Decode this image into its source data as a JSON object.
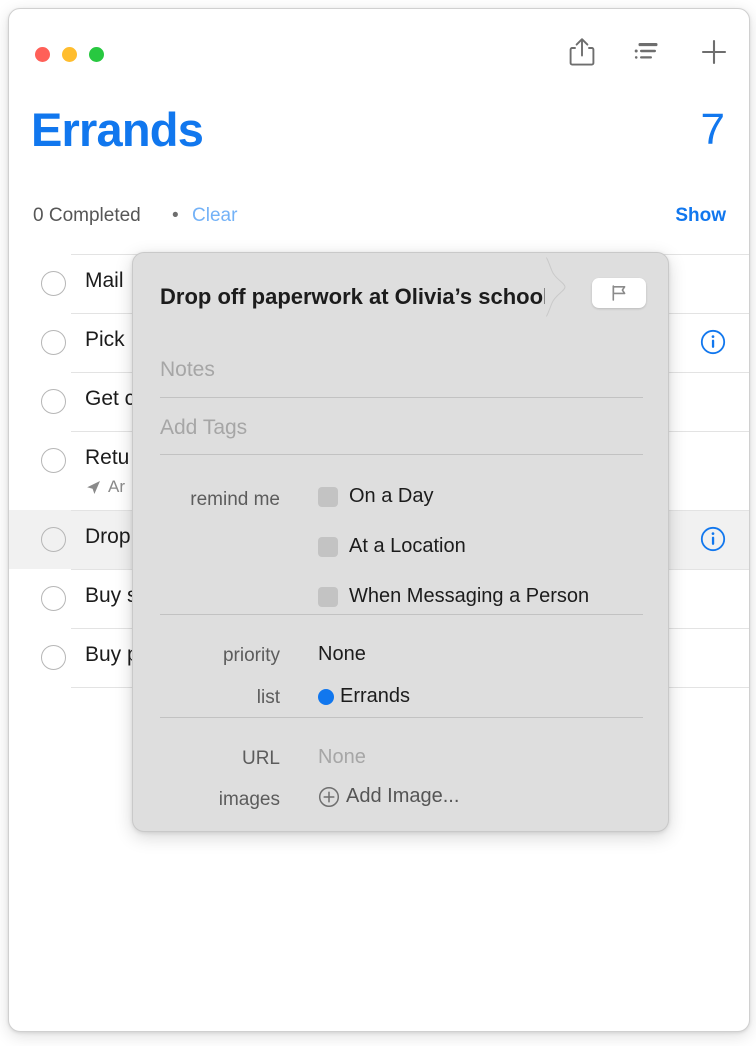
{
  "window": {
    "traffic_lights": [
      {
        "name": "close",
        "color": "#ff6058"
      },
      {
        "name": "minimize",
        "color": "#ffbd2e"
      },
      {
        "name": "zoom",
        "color": "#28c840"
      }
    ],
    "toolbar": [
      {
        "icon": "share-icon"
      },
      {
        "icon": "view-options-icon"
      },
      {
        "icon": "add-icon"
      }
    ]
  },
  "header": {
    "title": "Errands",
    "count": "7",
    "accent_color": "#1177ee",
    "completed_text": "0 Completed",
    "separator": "•",
    "clear_label": "Clear",
    "show_label": "Show"
  },
  "reminders": [
    {
      "title": "Mail",
      "selected": false,
      "has_info": false,
      "subtext": null
    },
    {
      "title": "Pick",
      "selected": false,
      "has_info": true,
      "subtext": null
    },
    {
      "title": "Get c",
      "selected": false,
      "has_info": false,
      "subtext": null
    },
    {
      "title": "Retu",
      "selected": false,
      "has_info": false,
      "subtext": "Ar"
    },
    {
      "title": "Drop",
      "selected": true,
      "has_info": true,
      "subtext": null
    },
    {
      "title": "Buy s",
      "selected": false,
      "has_info": false,
      "subtext": null
    },
    {
      "title": "Buy p",
      "selected": false,
      "has_info": false,
      "subtext": null
    }
  ],
  "popover": {
    "title": "Drop off paperwork at Olivia’s school",
    "flag_icon": "flag-icon",
    "notes_placeholder": "Notes",
    "tags_placeholder": "Add Tags",
    "remind_me_label": "remind me",
    "remind_options": [
      {
        "label": "On a Day",
        "checked": false
      },
      {
        "label": "At a Location",
        "checked": false
      },
      {
        "label": "When Messaging a Person",
        "checked": false
      }
    ],
    "priority_label": "priority",
    "priority_value": "None",
    "list_label": "list",
    "list_value": "Errands",
    "list_color": "#1177ee",
    "url_label": "URL",
    "url_value": "None",
    "images_label": "images",
    "add_image_label": "Add Image..."
  }
}
